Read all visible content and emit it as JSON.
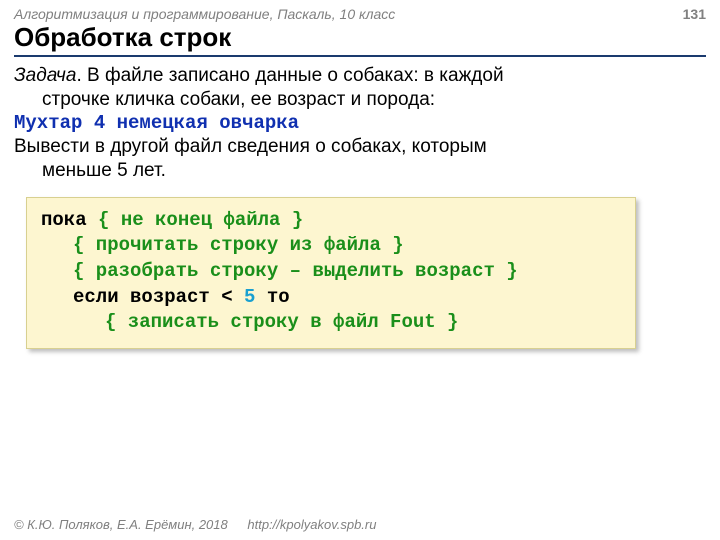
{
  "header": {
    "course": "Алгоритмизация и программирование, Паскаль, 10 класс",
    "page": "131"
  },
  "title": "Обработка строк",
  "task": {
    "label": "Задача",
    "line1_rest": ". В файле записано данные о собаках: в каждой",
    "line2": "строчке кличка собаки, ее возраст и порода:",
    "example": "Мухтар 4 немецкая овчарка",
    "line3": "Вывести в другой файл сведения о собаках, которым",
    "line4": "меньше 5 лет."
  },
  "code": {
    "l1_kw": "пока ",
    "l1_cm": "{ не конец файла }",
    "l2_cm": "{ прочитать строку из файла }",
    "l3_cm": "{ разобрать строку – выделить возраст }",
    "l4_kw1": "если возраст ",
    "l4_lt": "< ",
    "l4_num": "5",
    "l4_kw2": " то",
    "l5_cm": "{ записать строку в файл Fout }"
  },
  "footer": {
    "copyright": "© К.Ю. Поляков, Е.А. Ерёмин, 2018",
    "url": "http://kpolyakov.spb.ru"
  }
}
